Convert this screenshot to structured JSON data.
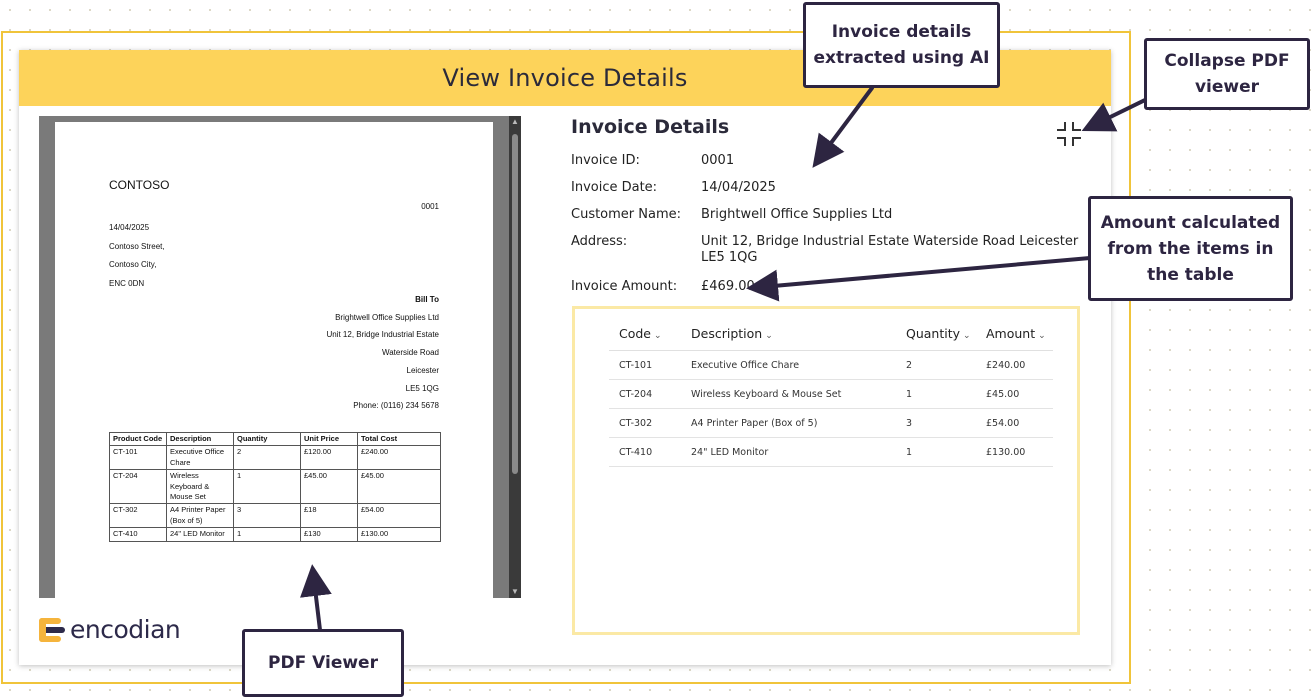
{
  "app": {
    "title": "View Invoice Details"
  },
  "pdf": {
    "company": "CONTOSO",
    "invoice_no": "0001",
    "from_lines": [
      "14/04/2025",
      "Contoso Street,",
      "Contoso City,",
      "ENC 0DN"
    ],
    "bill_to_heading": "Bill To",
    "bill_to_lines": [
      "Brightwell Office Supplies Ltd",
      "Unit 12, Bridge Industrial Estate",
      "Waterside Road",
      "Leicester",
      "LE5 1QG",
      "Phone: (0116) 234 5678"
    ],
    "table": {
      "headers": [
        "Product Code",
        "Description",
        "Quantity",
        "Unit Price",
        "Total Cost"
      ],
      "rows": [
        [
          "CT-101",
          "Executive Office Chare",
          "2",
          "£120.00",
          "£240.00"
        ],
        [
          "CT-204",
          "Wireless Keyboard & Mouse Set",
          "1",
          "£45.00",
          "£45.00"
        ],
        [
          "CT-302",
          "A4 Printer Paper (Box of 5)",
          "3",
          "£18",
          "£54.00"
        ],
        [
          "CT-410",
          "24\" LED Monitor",
          "1",
          "£130",
          "£130.00"
        ]
      ]
    }
  },
  "brand": {
    "logo_text": "encodian",
    "logo_colors": [
      "#f5b43c",
      "#2d2a4a"
    ]
  },
  "details": {
    "title": "Invoice Details",
    "fields": [
      {
        "label": "Invoice ID:",
        "value": "0001"
      },
      {
        "label": "Invoice Date:",
        "value": "14/04/2025"
      },
      {
        "label": "Customer Name:",
        "value": "Brightwell Office Supplies Ltd"
      },
      {
        "label": "Address:",
        "value": "Unit 12, Bridge Industrial Estate Waterside Road Leicester LE5 1QG"
      },
      {
        "label": "Invoice Amount:",
        "value": "£469.00"
      }
    ]
  },
  "items": {
    "headers": [
      "Code",
      "Description",
      "Quantity",
      "Amount"
    ],
    "rows": [
      [
        "CT-101",
        "Executive Office Chare",
        "2",
        "£240.00"
      ],
      [
        "CT-204",
        "Wireless Keyboard & Mouse Set",
        "1",
        "£45.00"
      ],
      [
        "CT-302",
        "A4 Printer Paper (Box of 5)",
        "3",
        "£54.00"
      ],
      [
        "CT-410",
        "24\" LED Monitor",
        "1",
        "£130.00"
      ]
    ]
  },
  "callouts": {
    "ai": "Invoice details extracted using AI",
    "collapse": "Collapse PDF viewer",
    "amount": "Amount calculated from the items in the table",
    "pdf": "PDF Viewer"
  },
  "icons": {
    "collapse": "collapse-icon",
    "sort": "chevron-down-icon"
  },
  "colors": {
    "header": "#fdd35a",
    "frame": "#f0c43a",
    "callout": "#2d2541",
    "items_border": "#fbe9a5"
  }
}
